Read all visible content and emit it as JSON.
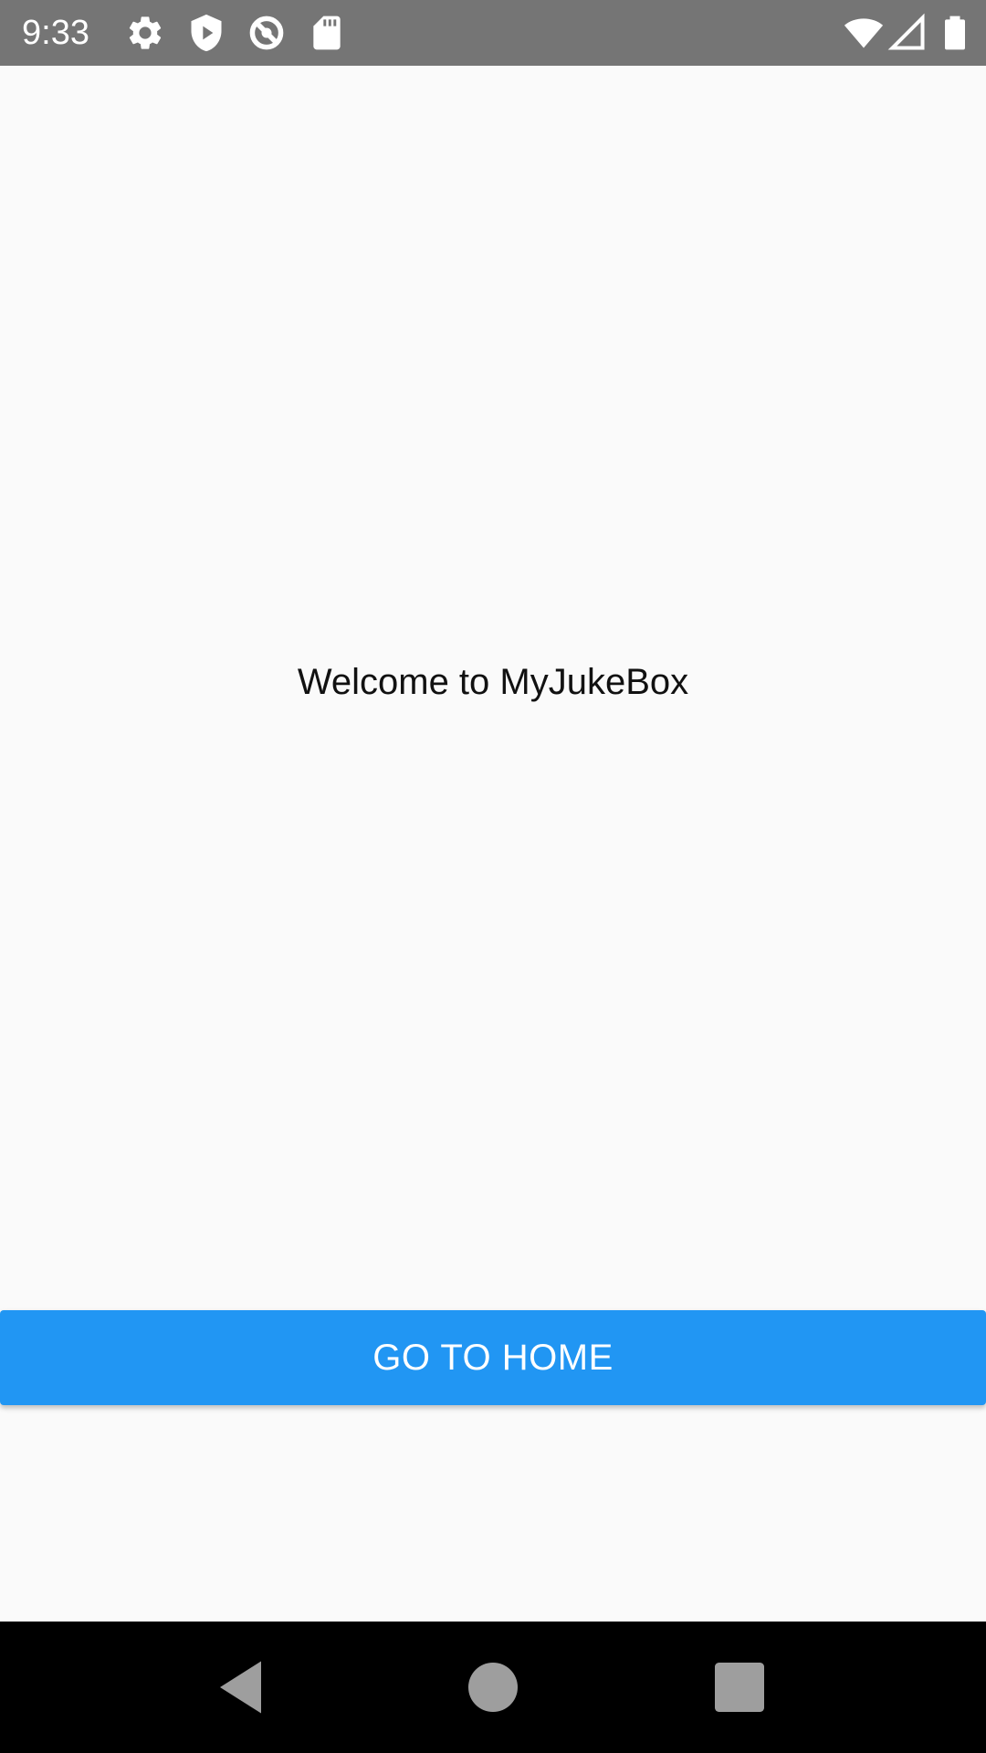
{
  "status_bar": {
    "time": "9:33",
    "left_icons": [
      "gear-icon",
      "shield-play-icon",
      "data-saver-icon",
      "sd-card-icon"
    ],
    "right_icons": [
      "wifi-icon",
      "cellular-signal-icon",
      "battery-icon"
    ]
  },
  "main": {
    "welcome_text": "Welcome to MyJukeBox",
    "home_button_label": "GO TO HOME"
  },
  "nav_bar": {
    "buttons": [
      "back-icon",
      "home-icon",
      "recents-icon"
    ]
  },
  "colors": {
    "status_bar": "#757575",
    "background": "#fafafa",
    "primary_button": "#2196f3",
    "nav_bar": "#000000"
  }
}
